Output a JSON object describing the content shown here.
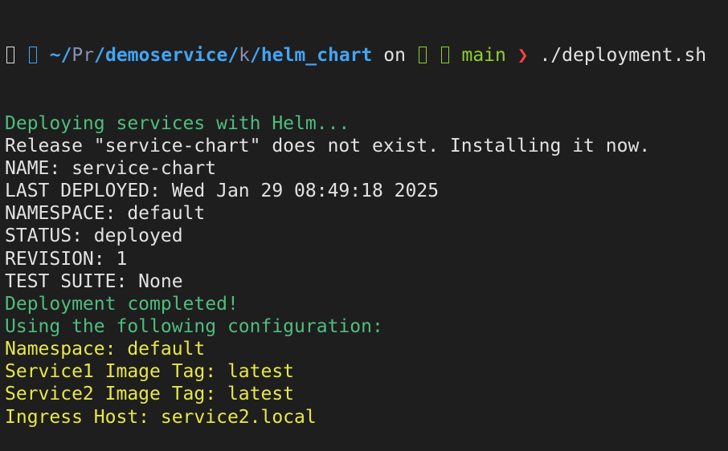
{
  "prompt": {
    "glyph1_icon": "missing-glyph-box",
    "glyph2_icon": "missing-glyph-box",
    "tilde": "~/",
    "seg1": "Pr",
    "sep1": "/",
    "seg2": "demoservice",
    "sep2": "/",
    "seg3": "k",
    "sep3": "/",
    "seg4": "helm_chart",
    "on": " on ",
    "branch": "main",
    "arrow": "❯",
    "command": " ./deployment.sh"
  },
  "output": [
    {
      "text": "Deploying services with Helm...",
      "color": "#4fbd7f"
    },
    {
      "text": "Release \"service-chart\" does not exist. Installing it now.",
      "color": "#e2e2e2"
    },
    {
      "text": "NAME: service-chart",
      "color": "#e2e2e2"
    },
    {
      "text": "LAST DEPLOYED: Wed Jan 29 08:49:18 2025",
      "color": "#e2e2e2"
    },
    {
      "text": "NAMESPACE: default",
      "color": "#e2e2e2"
    },
    {
      "text": "STATUS: deployed",
      "color": "#e2e2e2"
    },
    {
      "text": "REVISION: 1",
      "color": "#e2e2e2"
    },
    {
      "text": "TEST SUITE: None",
      "color": "#e2e2e2"
    },
    {
      "text": "Deployment completed!",
      "color": "#4fbd7f"
    },
    {
      "text": "Using the following configuration:",
      "color": "#4fbd7f"
    },
    {
      "text": "Namespace: default",
      "color": "#e8e845"
    },
    {
      "text": "Service1 Image Tag: latest",
      "color": "#e8e845"
    },
    {
      "text": "Service2 Image Tag: latest",
      "color": "#e8e845"
    },
    {
      "text": "Ingress Host: service2.local",
      "color": "#e8e845"
    }
  ]
}
